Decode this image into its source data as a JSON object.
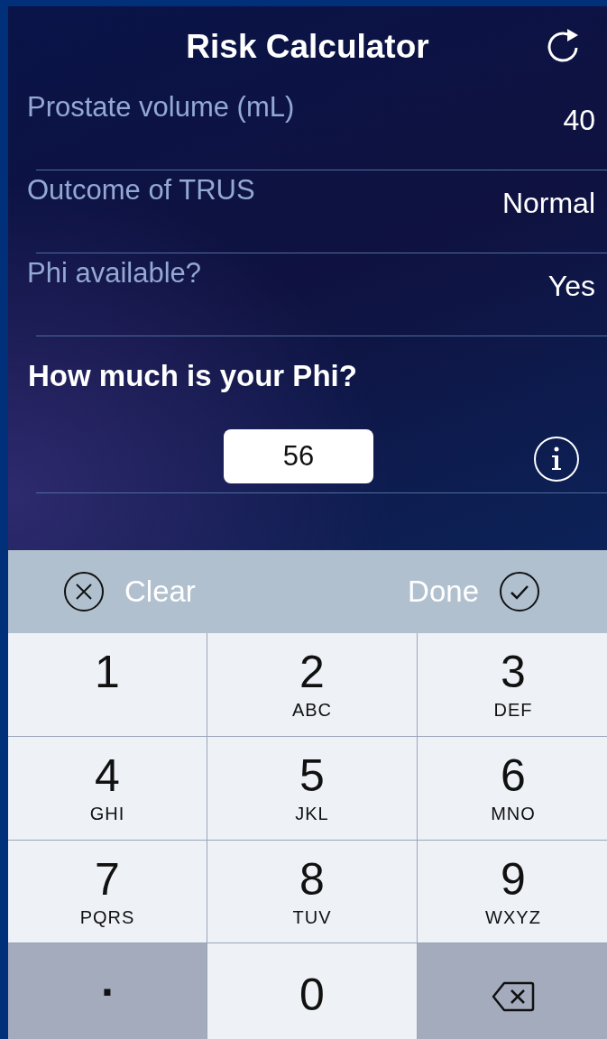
{
  "header": {
    "title": "Risk Calculator"
  },
  "fields": [
    {
      "label": "Prostate volume (mL)",
      "value": "40"
    },
    {
      "label": "Outcome of TRUS",
      "value": "Normal"
    },
    {
      "label": "Phi available?",
      "value": "Yes"
    }
  ],
  "question": {
    "text": "How much is your Phi?",
    "value": "56"
  },
  "toolbar": {
    "clear": "Clear",
    "done": "Done"
  },
  "keys": [
    {
      "kind": "digit",
      "label": "1"
    },
    {
      "kind": "digit",
      "label": "2",
      "letters": "ABC"
    },
    {
      "kind": "digit",
      "label": "3",
      "letters": "DEF"
    },
    {
      "kind": "digit",
      "label": "4",
      "letters": "GHI"
    },
    {
      "kind": "digit",
      "label": "5",
      "letters": "JKL"
    },
    {
      "kind": "digit",
      "label": "6",
      "letters": "MNO"
    },
    {
      "kind": "digit",
      "label": "7",
      "letters": "PQRS"
    },
    {
      "kind": "digit",
      "label": "8",
      "letters": "TUV"
    },
    {
      "kind": "digit",
      "label": "9",
      "letters": "WXYZ"
    },
    {
      "kind": "symbol",
      "label": "."
    },
    {
      "kind": "digit",
      "label": "0"
    },
    {
      "kind": "delete"
    }
  ]
}
